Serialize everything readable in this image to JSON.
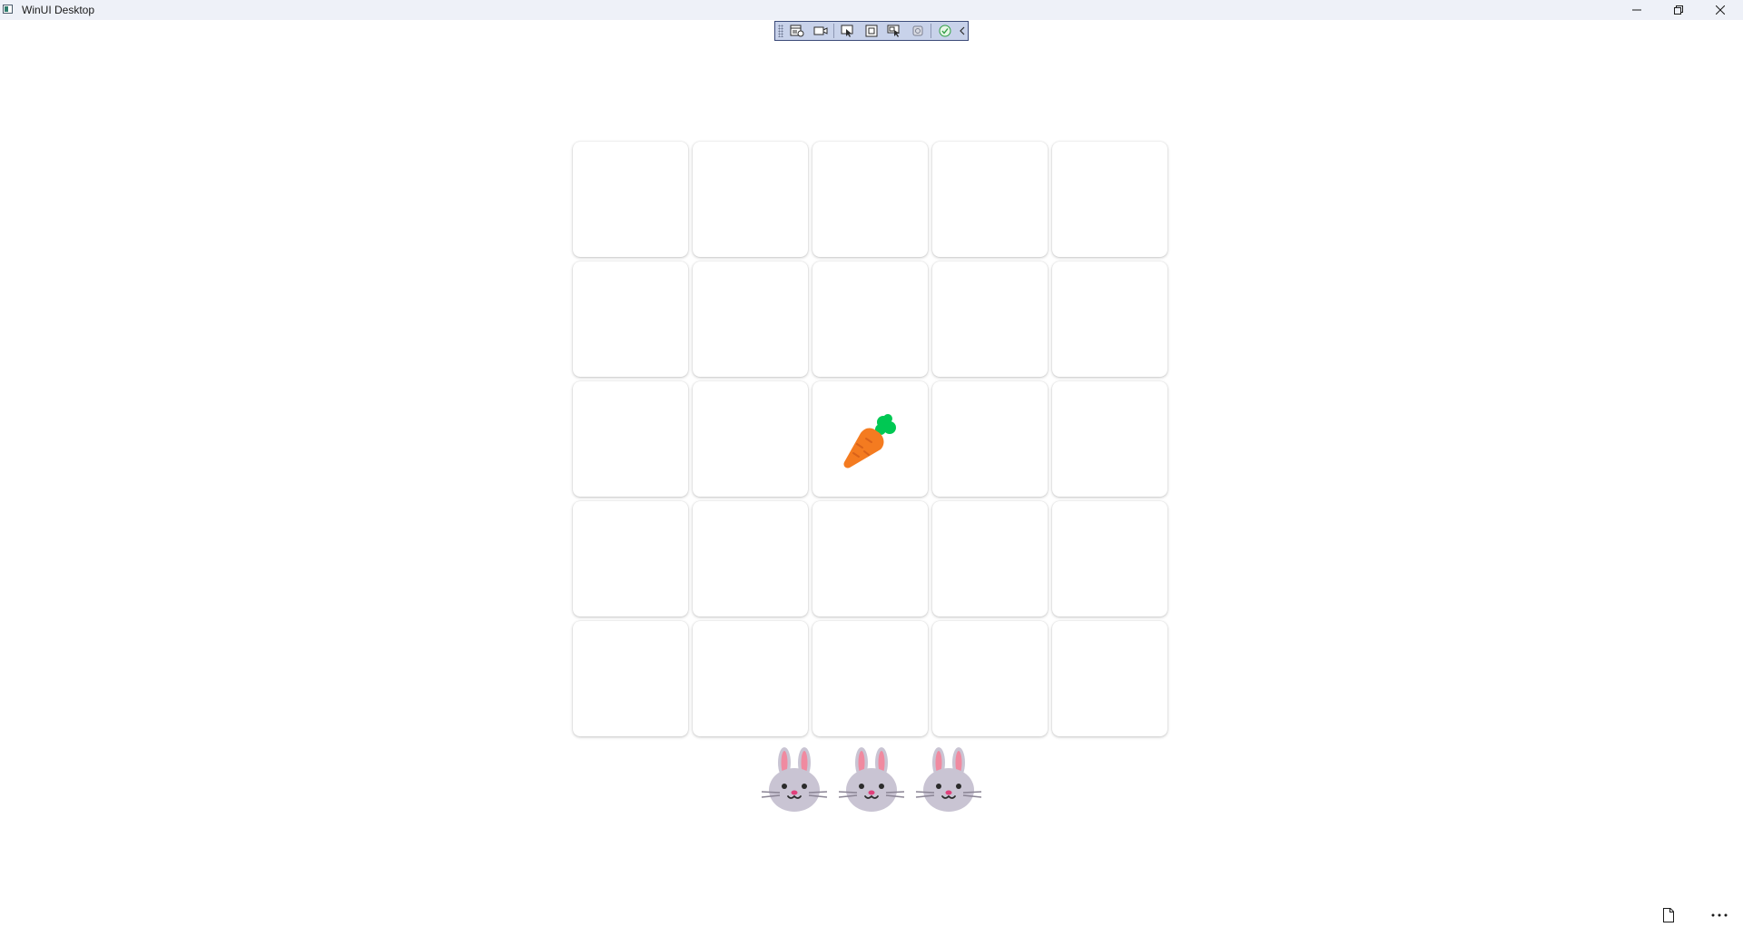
{
  "window": {
    "title": "WinUI Desktop",
    "controls": {
      "minimize_icon": "minimize-icon",
      "maximize_icon": "restore-icon",
      "close_icon": "close-icon"
    }
  },
  "debug_toolbar": {
    "buttons": [
      "live-visual-tree-icon",
      "record-icon",
      "select-element-icon",
      "display-layout-adorners-icon",
      "track-focused-element-icon",
      "hot-reload-icon",
      "accessibility-check-icon",
      "collapse-chevron-icon"
    ]
  },
  "game": {
    "grid": {
      "rows": 5,
      "cols": 5,
      "carrot_cell": {
        "row": 3,
        "col": 3
      }
    },
    "carrot": "carrot",
    "lives": 3,
    "life_icon": "rabbit-face"
  },
  "footer": {
    "icons": [
      "file-icon",
      "more-icon"
    ]
  },
  "colors": {
    "titlebar_bg": "#eef1f8",
    "background": "#ffffff",
    "carrot_orange": "#f47b20",
    "carrot_leaf": "#00c853",
    "bunny_gray": "#c9c4d3",
    "bunny_ear_pink": "#f08aa0"
  }
}
